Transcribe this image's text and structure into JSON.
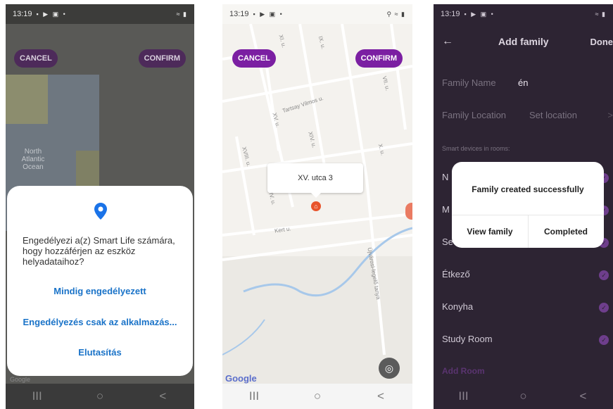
{
  "phone1": {
    "status": {
      "time": "13:19",
      "icons": "▪ ▶ ▣ •",
      "right": "≈ ▮"
    },
    "map": {
      "ocean_label": "North Atlantic Ocean"
    },
    "cancel": "CANCEL",
    "confirm": "CONFIRM",
    "dialog": {
      "message": "Engedélyezi a(z) Smart Life számára, hogy hozzáférjen az eszköz helyadataihoz?",
      "options": [
        "Mindig engedélyezett",
        "Engedélyezés csak az alkalmazás...",
        "Elutasítás"
      ]
    },
    "google": "Google",
    "nav": [
      "III",
      "○",
      "<"
    ]
  },
  "phone2": {
    "status": {
      "time": "13:19",
      "icons": "▪ ▶ ▣ •",
      "right": "⚲ ≈ ▮"
    },
    "cancel": "CANCEL",
    "confirm": "CONFIRM",
    "callout": "XV. utca 3",
    "roads": [
      "Tartsay Vilmos u.",
      "Kert u.",
      "Újvárosi-legelő tanya",
      "XI. u.",
      "IX. u.",
      "VII. u.",
      "XV. u.",
      "XIV. u.",
      "XVIII. u.",
      "XVII. u.",
      "X. u.",
      "XVI. u.",
      "IV. u."
    ],
    "google": "Google",
    "nav": [
      "III",
      "○",
      "<"
    ]
  },
  "phone3": {
    "status": {
      "time": "13:19",
      "icons": "▪ ▶ ▣ •",
      "right": "≈ ▮"
    },
    "header": {
      "back": "←",
      "title": "Add family",
      "done": "Done"
    },
    "family_name": {
      "label": "Family Name",
      "value": "én"
    },
    "family_location": {
      "label": "Family Location",
      "value": "Set location",
      "chevron": ">"
    },
    "section_label": "Smart devices in rooms:",
    "rooms": [
      "N",
      "M",
      "Se",
      "Étkező",
      "Konyha",
      "Study Room"
    ],
    "add_room": "Add Room",
    "modal": {
      "title": "Family created successfully",
      "left_btn": "View family",
      "right_btn": "Completed"
    },
    "nav": [
      "III",
      "○",
      "<"
    ]
  }
}
